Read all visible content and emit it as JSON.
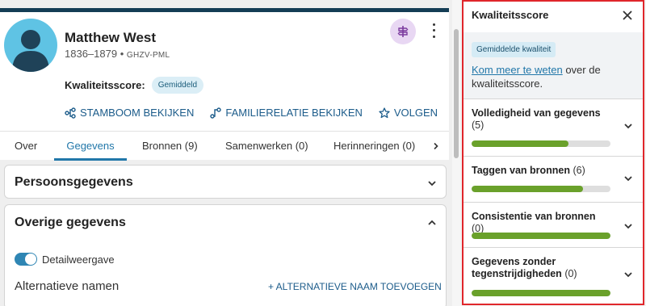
{
  "person": {
    "name": "Matthew West",
    "lifespan": "1836–1879",
    "separator": "•",
    "pid": "GHZV-PML",
    "quality_label": "Kwaliteitsscore:",
    "quality_value": "Gemiddeld"
  },
  "actions": [
    {
      "label": "STAMBOOM BEKIJKEN",
      "icon": "tree-icon"
    },
    {
      "label": "FAMILIERELATIE BEKIJKEN",
      "icon": "relationship-icon"
    },
    {
      "label": "VOLGEN",
      "icon": "star-icon"
    }
  ],
  "tabs": [
    {
      "label": "Over"
    },
    {
      "label": "Gegevens",
      "active": true
    },
    {
      "label": "Bronnen (9)"
    },
    {
      "label": "Samenwerken (0)"
    },
    {
      "label": "Herinneringen (0)"
    }
  ],
  "sections": {
    "persoons": {
      "title": "Persoonsgegevens",
      "expanded": false
    },
    "overige": {
      "title": "Overige gegevens",
      "expanded": true,
      "toggle_label": "Detailweergave",
      "toggle_on": true,
      "alt_names_title": "Alternatieve namen",
      "alt_names_add": "+ ALTERNATIEVE NAAM TOEVOEGEN"
    }
  },
  "panel": {
    "title": "Kwaliteitsscore",
    "badge": "Gemiddelde kwaliteit",
    "link_text": "Kom meer te weten",
    "text_after": " over de kwaliteitsscore.",
    "metrics": [
      {
        "title": "Volledigheid van gegevens",
        "count": "(5)",
        "progress": 0.7
      },
      {
        "title": "Taggen van bronnen",
        "count": "(6)",
        "progress": 0.8
      },
      {
        "title": "Consistentie van bronnen",
        "count": "(0)",
        "progress": 1.0
      },
      {
        "title": "Gegevens zonder tegenstrijdigheden",
        "count": "(0)",
        "progress": 1.0
      }
    ]
  },
  "colors": {
    "accent": "#2177a9",
    "progress": "#6aa12b",
    "avatar_bg": "#5fc3e4",
    "highlight_border": "#e0262b"
  }
}
